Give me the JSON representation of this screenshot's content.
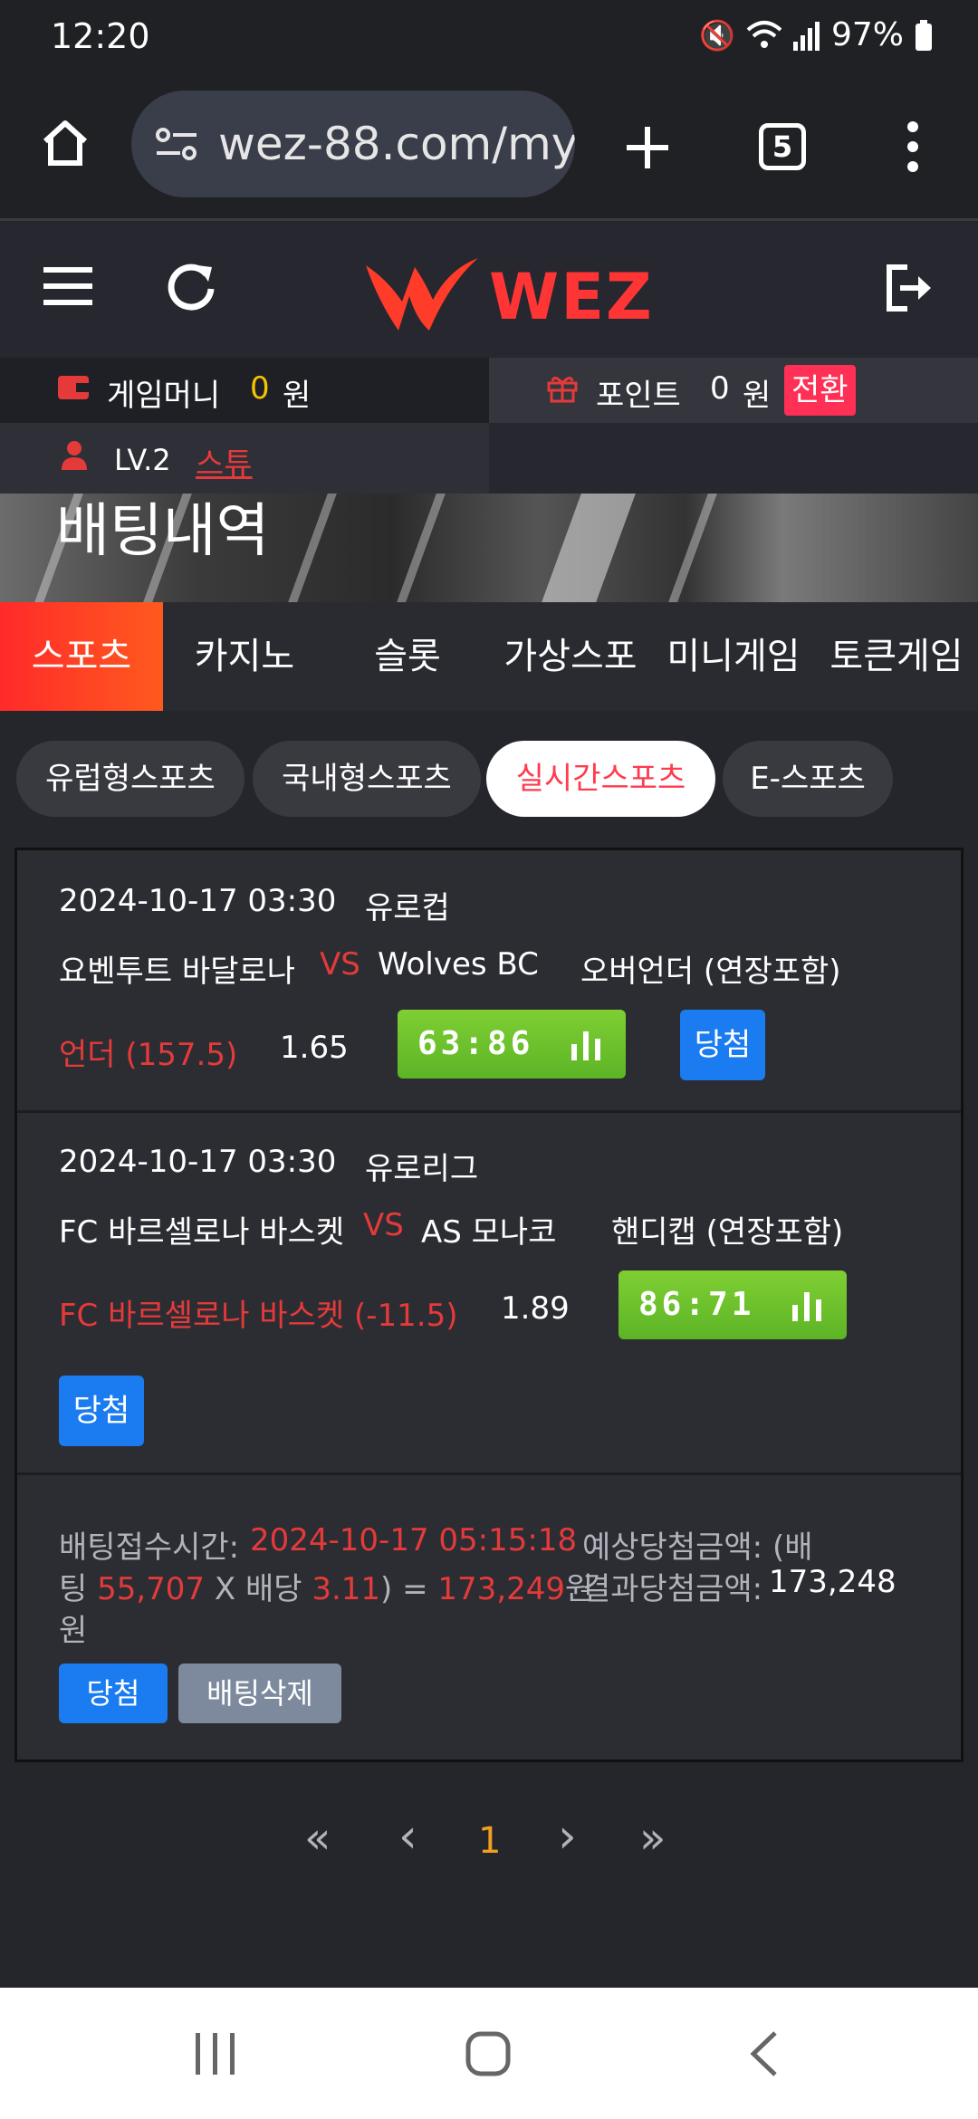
{
  "status": {
    "time": "12:20",
    "battery": "97%"
  },
  "browser": {
    "url": "wez-88.com/my",
    "tab_count": "5"
  },
  "site": {
    "logo": "WEZ"
  },
  "account": {
    "game_money_label": "게임머니",
    "game_money_value": "0",
    "game_money_unit": "원",
    "point_label": "포인트",
    "point_value": "0",
    "point_unit": "원",
    "convert_label": "전환",
    "level": "LV.2",
    "user": "스튜"
  },
  "banner": {
    "title": "배팅내역"
  },
  "category_tabs": [
    "스포츠",
    "카지노",
    "슬롯",
    "가상스포츠",
    "미니게임",
    "토큰게임"
  ],
  "sub_tabs": [
    "유럽형스포츠",
    "국내형스포츠",
    "실시간스포츠",
    "E-스포츠"
  ],
  "bets": [
    {
      "datetime": "2024-10-17 03:30",
      "league": "유로컵",
      "home": "요벤투트 바달로나",
      "vs": "VS",
      "away": "Wolves BC",
      "market": "오버언더 (연장포함)",
      "pick": "언더 (157.5)",
      "odds": "1.65",
      "score": "63:86",
      "result": "당첨"
    },
    {
      "datetime": "2024-10-17 03:30",
      "league": "유로리그",
      "home": "FC 바르셀로나 바스켓",
      "vs": "VS",
      "away": "AS 모나코",
      "market": "핸디캡 (연장포함)",
      "pick": "FC 바르셀로나 바스켓 (-11.5)",
      "odds": "1.89",
      "score": "86:71",
      "result": "당첨"
    }
  ],
  "summary": {
    "time_label": "배팅접수시간:",
    "time_value": "2024-10-17 05:15:18",
    "expected_label": "예상당첨금액: (배",
    "line2_a": "팅 ",
    "stake": "55,707",
    "x_label": " X 배당 ",
    "total_odds": "3.11",
    "eq": ") = ",
    "expected_value": "173,249",
    "unit": "원",
    "line3": "원",
    "result_label": "결과당첨금액:",
    "result_value": "173,248",
    "status_button": "당첨",
    "delete_button": "배팅삭제"
  },
  "pagination": {
    "first": "«",
    "prev": "‹",
    "current": "1",
    "next": "›",
    "last": "»"
  },
  "colors": {
    "accent_red": "#e53a3a",
    "win_blue": "#1a7cf0",
    "score_green": "#6cc02c"
  }
}
